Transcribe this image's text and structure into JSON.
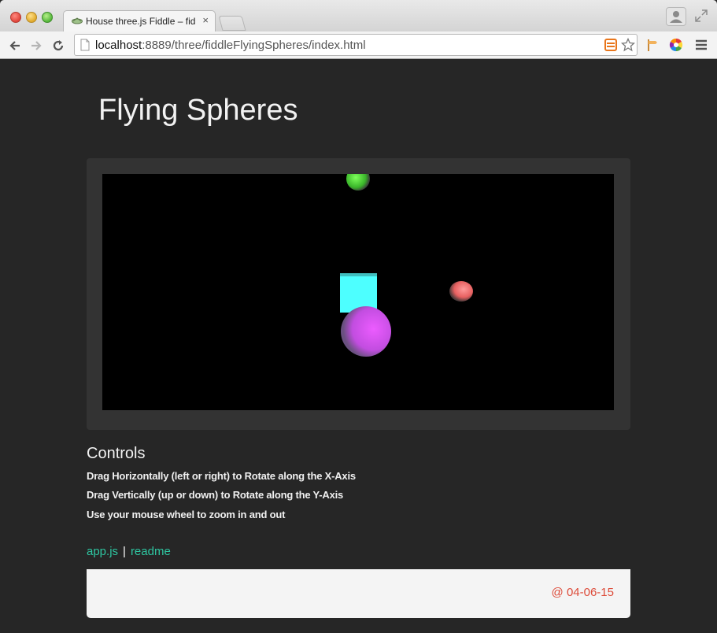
{
  "browser": {
    "tab": {
      "title": "House three.js Fiddle – fid",
      "close": "×"
    },
    "address_bar": {
      "host": "localhost",
      "path": ":8889/three/fiddleFlyingSpheres/index.html"
    },
    "icons": {
      "back": "back-arrow-icon",
      "forward": "forward-arrow-icon",
      "reload": "reload-icon",
      "bookmark": "star-icon",
      "menu": "hamburger-menu-icon"
    }
  },
  "page": {
    "title": "Flying Spheres",
    "controls": {
      "heading": "Controls",
      "lines": [
        "Drag Horizontally (left or right) to Rotate along the X-Axis",
        "Drag Vertically (up or down) to Rotate along the Y-Axis",
        "Use your mouse wheel to zoom in and out"
      ]
    },
    "links": {
      "app": "app.js",
      "separator": "|",
      "readme": "readme"
    },
    "footer": {
      "date": "@ 04-06-15"
    }
  },
  "colors": {
    "accent_link": "#2ec6a1",
    "footer_date": "#dd4b39",
    "cube": "#4dffff",
    "sphere_green": "#4ed43a",
    "sphere_pink": "#f07070",
    "sphere_magenta": "#d94cf0"
  }
}
